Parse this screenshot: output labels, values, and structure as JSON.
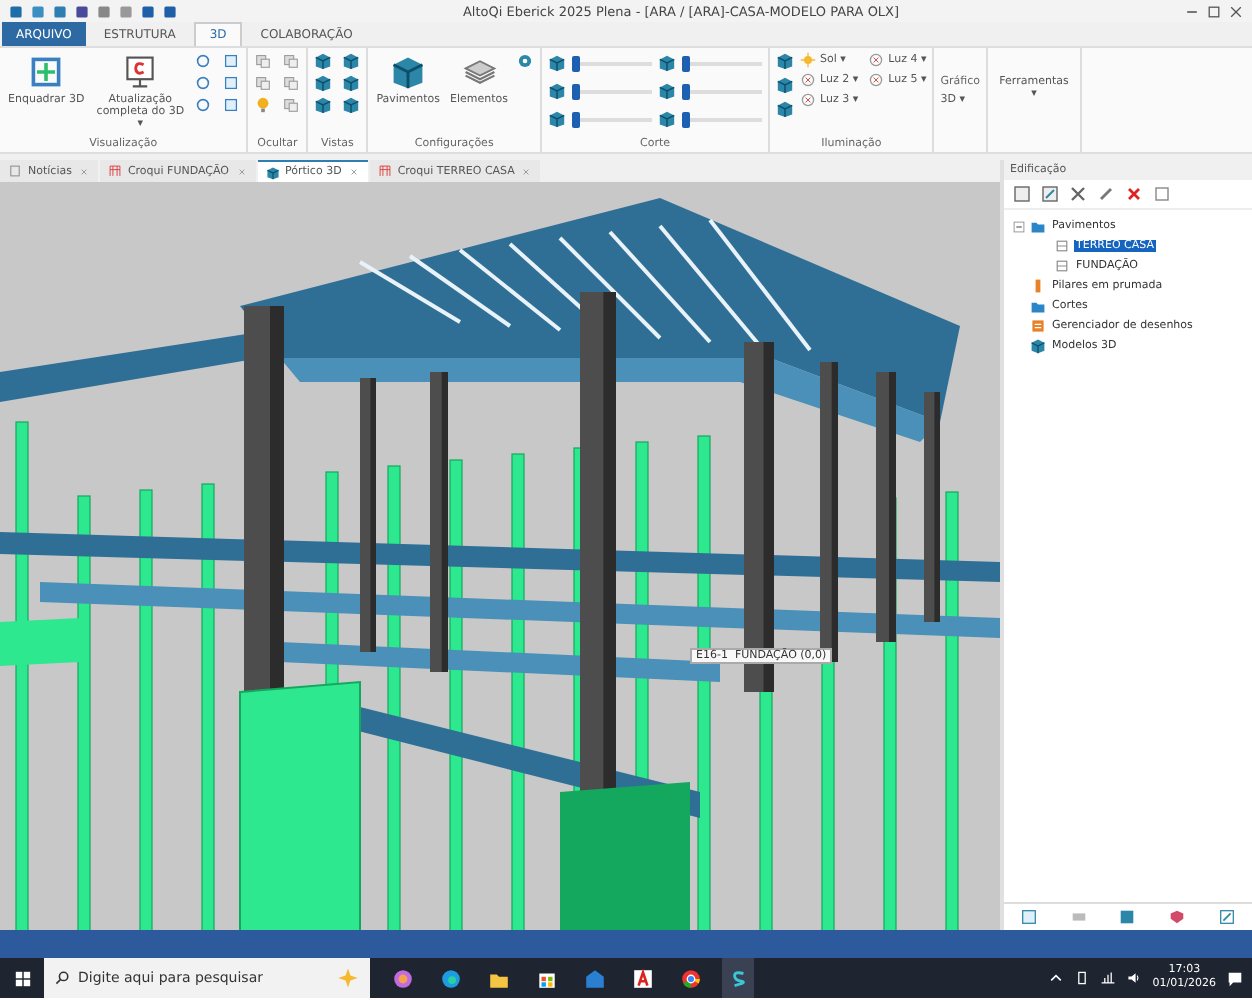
{
  "window": {
    "title": "AltoQi Eberick 2025 Plena - [ARA / [ARA]-CASA-MODELO PARA OLX]"
  },
  "ribbon_tabs": [
    {
      "label": "ARQUIVO",
      "kind": "file",
      "selected": false
    },
    {
      "label": "ESTRUTURA",
      "kind": "tab",
      "selected": false
    },
    {
      "label": "3D",
      "kind": "tab",
      "selected": true
    },
    {
      "label": "COLABORAÇÃO",
      "kind": "tab",
      "selected": false
    }
  ],
  "ribbon_groups": [
    {
      "kind": "view",
      "title": "Visualização",
      "buttons": [
        "Enquadrar 3D",
        "Atualização completa do 3D ▾"
      ]
    },
    {
      "kind": "hide",
      "title": "Ocultar"
    },
    {
      "kind": "views",
      "title": "Vistas"
    },
    {
      "kind": "config",
      "title": "Configurações",
      "buttons": [
        "Pavimentos",
        "Elementos"
      ]
    },
    {
      "kind": "cut",
      "title": "Corte",
      "sliders": [
        {
          "level": 0.06
        },
        {
          "level": 0.06
        },
        {
          "level": 0.06
        },
        {
          "level": 0.06
        },
        {
          "level": 0.06
        },
        {
          "level": 0.06
        }
      ]
    },
    {
      "kind": "light",
      "title": "Iluminação",
      "buttons": [
        "Sol ▾",
        "Luz 4 ▾",
        "Luz 2 ▾",
        "Luz 5 ▾",
        "Luz 3 ▾"
      ]
    },
    {
      "kind": "graphic",
      "title": "Gráfico",
      "buttons": [
        "3D ▾"
      ]
    },
    {
      "kind": "tools",
      "buttons": [
        "Ferramentas ▾"
      ]
    }
  ],
  "document_tabs": [
    {
      "label": "Notícias",
      "kind": "news",
      "selected": false
    },
    {
      "label": "Croqui FUNDAÇÃO",
      "kind": "sketch",
      "selected": false
    },
    {
      "label": "Pórtico 3D",
      "kind": "model",
      "selected": true
    },
    {
      "label": "Croqui TERREO CASA",
      "kind": "sketch",
      "selected": false
    }
  ],
  "viewport": {
    "tooltip": "E16-1  FUNDAÇÃO (0,0)"
  },
  "side_panel": {
    "title": "Edificação",
    "tree": [
      {
        "label": "Pavimentos",
        "kind": "folder",
        "expanded": true,
        "selected": false,
        "children": [
          {
            "label": "TERREO CASA",
            "kind": "floor",
            "selected": true
          },
          {
            "label": "FUNDAÇÃO",
            "kind": "floor",
            "selected": false
          }
        ]
      },
      {
        "label": "Pilares em prumada",
        "kind": "pillar",
        "selected": false
      },
      {
        "label": "Cortes",
        "kind": "folder",
        "selected": false
      },
      {
        "label": "Gerenciador de desenhos",
        "kind": "drawings",
        "selected": false
      },
      {
        "label": "Modelos 3D",
        "kind": "model",
        "selected": false
      }
    ]
  },
  "taskbar": {
    "search_placeholder": "Digite aqui para pesquisar",
    "time": "17:03",
    "date": "01/01/2026"
  }
}
